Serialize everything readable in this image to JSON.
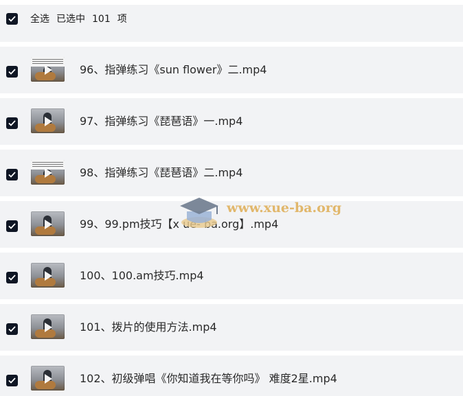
{
  "header": {
    "select_all": "全选",
    "selected_prefix": "已选中",
    "selected_count": "101",
    "selected_suffix": "项",
    "checked": true
  },
  "files": [
    {
      "name": "96、指弹练习《sun flower》二.mp4",
      "checked": true,
      "thumbnail": "sheet-music-video-thumbnail"
    },
    {
      "name": "97、指弹练习《琵琶语》一.mp4",
      "checked": true,
      "thumbnail": "guitar-video-thumbnail"
    },
    {
      "name": "98、指弹练习《琵琶语》二.mp4",
      "checked": true,
      "thumbnail": "sheet-music-video-thumbnail"
    },
    {
      "name": "99、99.pm技巧【x ue- ba.org】.mp4",
      "checked": true,
      "thumbnail": "guitar-video-thumbnail"
    },
    {
      "name": "100、100.am技巧.mp4",
      "checked": true,
      "thumbnail": "guitar-video-thumbnail"
    },
    {
      "name": "101、拨片的使用方法.mp4",
      "checked": true,
      "thumbnail": "guitar-video-thumbnail"
    },
    {
      "name": "102、初级弹唱《你知道我在等你吗》 难度2星.mp4",
      "checked": true,
      "thumbnail": "guitar-video-thumbnail"
    }
  ],
  "watermark": {
    "text": "www.xue-ba.org"
  },
  "colors": {
    "row_background": "#f2f3f5",
    "checkbox": "#0f1624",
    "text": "#2a2a2a",
    "watermark": "#deab52"
  }
}
